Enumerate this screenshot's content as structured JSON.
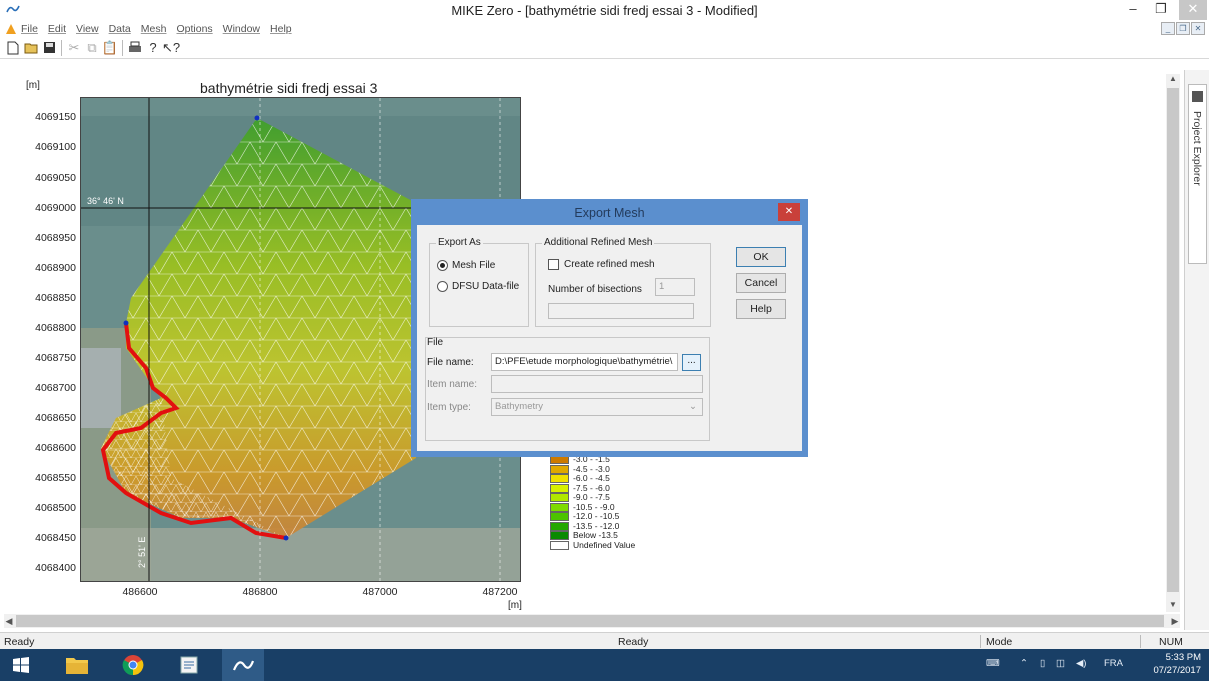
{
  "window": {
    "title": "MIKE Zero - [bathymétrie sidi fredj essai 3 - Modified]",
    "minimize_glyph": "–",
    "maximize_glyph": "❐",
    "close_glyph": "✕"
  },
  "menubar": {
    "items": [
      "File",
      "Edit",
      "View",
      "Data",
      "Mesh",
      "Options",
      "Window",
      "Help"
    ]
  },
  "toolbar": {
    "icons": [
      "new-icon",
      "open-icon",
      "save-icon",
      "cut-icon",
      "copy-icon",
      "paste-icon",
      "print-icon",
      "help-icon",
      "context-help-icon"
    ]
  },
  "plot": {
    "title": "bathymétrie sidi fredj essai 3",
    "y_unit": "[m]",
    "x_unit": "[m]",
    "y_ticks": [
      "4069150",
      "4069100",
      "4069050",
      "4069000",
      "4068950",
      "4068900",
      "4068850",
      "4068800",
      "4068750",
      "4068700",
      "4068650",
      "4068600",
      "4068550",
      "4068500",
      "4068450",
      "4068400"
    ],
    "x_ticks": [
      "486600",
      "486800",
      "487000",
      "487200"
    ],
    "lat_label": "36° 46' N",
    "lon_label": "2° 51' E"
  },
  "legend": {
    "entries": [
      {
        "label": "-3.0 -  -1.5",
        "color": "#cc7a00"
      },
      {
        "label": "-4.5 -  -3.0",
        "color": "#e0a800"
      },
      {
        "label": "-6.0 -  -4.5",
        "color": "#f0e000"
      },
      {
        "label": "-7.5 -  -6.0",
        "color": "#d8f000"
      },
      {
        "label": "-9.0 -  -7.5",
        "color": "#b0e800"
      },
      {
        "label": "-10.5 -  -9.0",
        "color": "#7fdc00"
      },
      {
        "label": "-12.0 - -10.5",
        "color": "#4cc400"
      },
      {
        "label": "-13.5 - -12.0",
        "color": "#24a800"
      },
      {
        "label": "Below -13.5",
        "color": "#0a8a00"
      },
      {
        "label": "Undefined Value",
        "color": "#ffffff"
      }
    ]
  },
  "dialog": {
    "title": "Export Mesh",
    "close_glyph": "✕",
    "export_as": {
      "label": "Export As",
      "options": [
        "Mesh File",
        "DFSU Data-file"
      ],
      "selected": "Mesh File"
    },
    "refined": {
      "label": "Additional Refined Mesh",
      "checkbox_label": "Create refined mesh",
      "checked": false,
      "bisections_label": "Number of bisections",
      "bisections_value": "1"
    },
    "file": {
      "label": "File",
      "file_name_label": "File name:",
      "file_name_value": "D:\\PFE\\etude morphologique\\bathymétrie\\",
      "browse_label": "...",
      "item_name_label": "Item name:",
      "item_name_value": "",
      "item_type_label": "Item type:",
      "item_type_value": "Bathymetry"
    },
    "buttons": {
      "ok": "OK",
      "cancel": "Cancel",
      "help": "Help"
    }
  },
  "project_explorer": {
    "label": "Project Explorer"
  },
  "statusbar": {
    "left": "Ready",
    "center": "Ready",
    "mode": "Mode",
    "num": "NUM"
  },
  "taskbar": {
    "apps": [
      "start-icon",
      "file-explorer-icon",
      "chrome-icon",
      "notepad-icon",
      "mike-zero-icon"
    ],
    "lang": "FRA",
    "time": "5:33 PM",
    "date": "07/27/2017"
  }
}
